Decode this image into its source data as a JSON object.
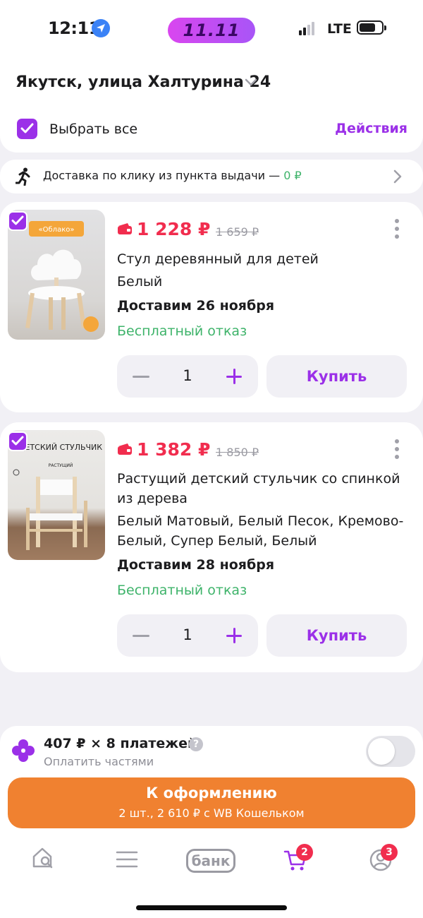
{
  "status_bar": {
    "time": "12:11",
    "promo": "11.11",
    "network": "LTE",
    "icons": [
      "location-arrow-icon",
      "signal-icon",
      "battery-icon"
    ]
  },
  "header": {
    "address": "Якутск, улица Халтурина 24",
    "select_all_label": "Выбрать все",
    "select_all_checked": true,
    "actions_label": "Действия"
  },
  "delivery": {
    "text": "Доставка по клику из пункта выдачи — ",
    "price": "0 ₽"
  },
  "items": [
    {
      "checked": true,
      "price": "1 228 ₽",
      "old_price": "1 659 ₽",
      "title": "Стул деревянный для детей",
      "variant": "Белый",
      "delivery": "Доставим 26 ноября",
      "refund": "Бесплатный отказ",
      "quantity": "1",
      "buy_label": "Купить",
      "image_label": "«Облако»"
    },
    {
      "checked": true,
      "price": "1 382 ₽",
      "old_price": "1 850 ₽",
      "title": "Растущий детский стульчик со спинкой из дерева",
      "variant": "Белый Матовый, Белый Песок, Кремово-Белый, Супер Белый, Белый",
      "delivery": "Доставим 28 ноября",
      "refund": "Бесплатный отказ",
      "quantity": "1",
      "buy_label": "Купить",
      "image_label": "ДЕТСКИЙ СТУЛЬЧИК",
      "image_sublabel": "РАСТУЩИЙ"
    }
  ],
  "installments": {
    "title": "407 ₽ × 8 платежей",
    "subtitle": "Оплатить частями",
    "help": "?",
    "enabled": false
  },
  "checkout": {
    "label": "К оформлению",
    "summary": "2 шт., 2 610 ₽ с WB Кошельком"
  },
  "tabbar": {
    "bank_label": "банк",
    "cart_badge": "2",
    "profile_badge": "3"
  },
  "colors": {
    "accent": "#9b30e8",
    "price": "#f12d4e",
    "success": "#3eb36a",
    "checkout": "#f08130",
    "background": "#f1f0f5"
  }
}
